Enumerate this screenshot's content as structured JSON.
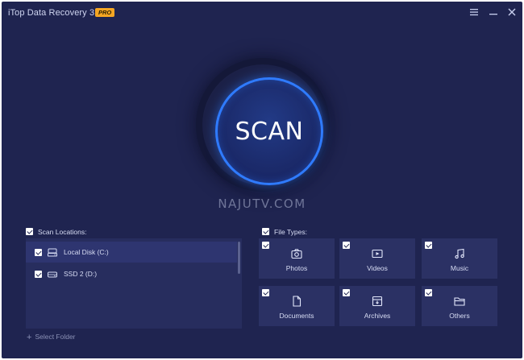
{
  "window": {
    "title": "iTop Data Recovery 3.1",
    "badge": "PRO",
    "controls": [
      "menu-icon",
      "minimize-icon",
      "close-icon"
    ]
  },
  "scan": {
    "label": "SCAN"
  },
  "watermark": "NAJUTV.COM",
  "locations": {
    "header": "Scan Locations:",
    "checked": true,
    "items": [
      {
        "label": "Local Disk (C:)",
        "icon": "hard-drive-icon",
        "checked": true
      },
      {
        "label": "SSD 2 (D:)",
        "icon": "hard-drive-icon",
        "checked": true
      }
    ],
    "select_folder": "Select Folder"
  },
  "file_types": {
    "header": "File Types:",
    "checked": true,
    "items": [
      {
        "label": "Photos",
        "icon": "camera-icon",
        "checked": true
      },
      {
        "label": "Videos",
        "icon": "video-icon",
        "checked": true
      },
      {
        "label": "Music",
        "icon": "music-note-icon",
        "checked": true
      },
      {
        "label": "Documents",
        "icon": "document-icon",
        "checked": true
      },
      {
        "label": "Archives",
        "icon": "archive-icon",
        "checked": true
      },
      {
        "label": "Others",
        "icon": "folder-icon",
        "checked": true
      }
    ]
  },
  "colors": {
    "background": "#1f2450",
    "panel": "#272d5e",
    "tile": "#2b3164",
    "accent": "#2f7bff",
    "badge": "#f5a623"
  }
}
